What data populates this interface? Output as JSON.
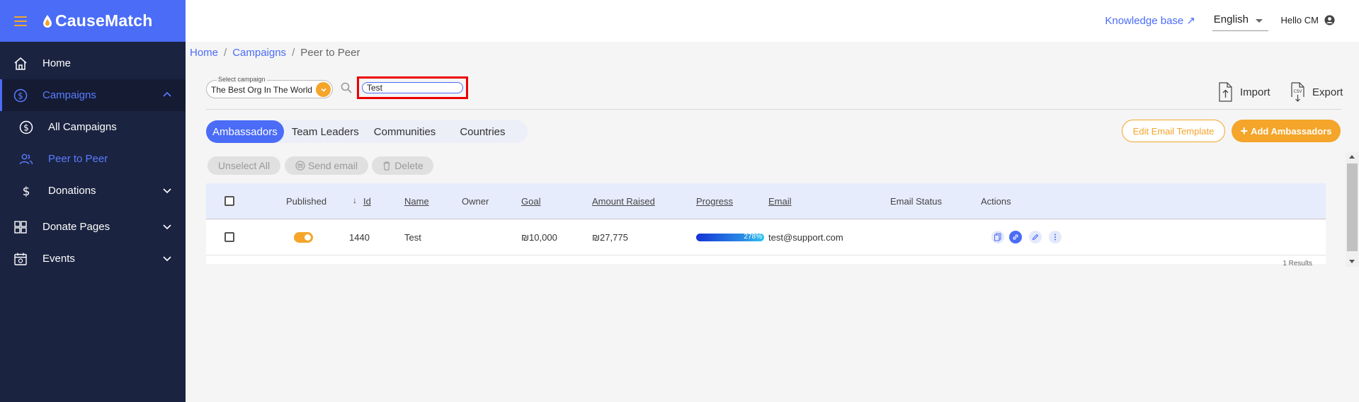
{
  "brand": {
    "name": "CauseMatch"
  },
  "sidebar": {
    "items": [
      {
        "label": "Home",
        "icon": "home-icon"
      },
      {
        "label": "Campaigns",
        "icon": "dollar-circle-icon",
        "expanded": true
      },
      {
        "label": "All Campaigns",
        "icon": "dollar-circle-icon"
      },
      {
        "label": "Peer to Peer",
        "icon": "users-icon",
        "current": true
      },
      {
        "label": "Donations",
        "icon": "dollar-icon"
      },
      {
        "label": "Donate Pages",
        "icon": "grid-icon"
      },
      {
        "label": "Events",
        "icon": "calendar-icon"
      }
    ]
  },
  "header": {
    "knowledge_base": "Knowledge base ↗",
    "language": "English",
    "greeting": "Hello CM"
  },
  "breadcrumb": {
    "home": "Home",
    "campaigns": "Campaigns",
    "current": "Peer to Peer"
  },
  "campaign_select": {
    "label": "Select campaign",
    "value": "The Best Org In The World"
  },
  "search": {
    "value": "Test"
  },
  "actions": {
    "import": "Import",
    "export": "Export"
  },
  "tabs": [
    "Ambassadors",
    "Team Leaders",
    "Communities",
    "Countries"
  ],
  "buttons": {
    "edit_template": "Edit Email Template",
    "add_ambassadors": "Add Ambassadors",
    "unselect_all": "Unselect All",
    "send_email": "Send email",
    "delete": "Delete"
  },
  "table": {
    "columns": {
      "published": "Published",
      "id": "Id",
      "name": "Name",
      "owner": "Owner",
      "goal": "Goal",
      "amount_raised": "Amount Raised",
      "progress": "Progress",
      "email": "Email",
      "email_status": "Email Status",
      "actions": "Actions"
    },
    "rows": [
      {
        "published": true,
        "id": "1440",
        "name": "Test",
        "owner": "",
        "goal": "₪10,000",
        "amount_raised": "₪27,775",
        "progress": "278%",
        "email": "test@support.com",
        "email_status": ""
      }
    ],
    "results": "1 Results"
  },
  "colors": {
    "primary": "#4a6cf7",
    "accent": "#f4a52a",
    "sidebar": "#1a2340"
  }
}
